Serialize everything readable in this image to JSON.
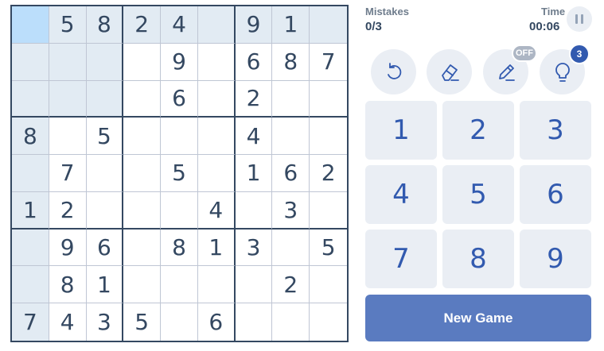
{
  "board": {
    "rows": [
      [
        "",
        "5",
        "8",
        "2",
        "4",
        "",
        "9",
        "1",
        ""
      ],
      [
        "",
        "",
        "",
        "",
        "9",
        "",
        "6",
        "8",
        "7"
      ],
      [
        "",
        "",
        "",
        "",
        "6",
        "",
        "2",
        "",
        ""
      ],
      [
        "8",
        "",
        "5",
        "",
        "",
        "",
        "4",
        "",
        ""
      ],
      [
        "",
        "7",
        "",
        "",
        "5",
        "",
        "1",
        "6",
        "2"
      ],
      [
        "1",
        "2",
        "",
        "",
        "",
        "4",
        "",
        "3",
        ""
      ],
      [
        "",
        "9",
        "6",
        "",
        "8",
        "1",
        "3",
        "",
        "5"
      ],
      [
        "",
        "8",
        "1",
        "",
        "",
        "",
        "",
        "2",
        ""
      ],
      [
        "7",
        "4",
        "3",
        "5",
        "",
        "6",
        "",
        "",
        ""
      ]
    ],
    "selected": {
      "row": 1,
      "col": 1
    }
  },
  "stats": {
    "mistakes_label": "Mistakes",
    "mistakes_value": "0/3",
    "time_label": "Time",
    "time_value": "00:06"
  },
  "tools": {
    "undo_icon": "undo-icon",
    "erase_icon": "eraser-icon",
    "notes_icon": "pencil-icon",
    "notes_badge": "OFF",
    "hint_icon": "lightbulb-icon",
    "hint_badge": "3"
  },
  "numpad": {
    "keys": [
      "1",
      "2",
      "3",
      "4",
      "5",
      "6",
      "7",
      "8",
      "9"
    ]
  },
  "new_game_label": "New Game",
  "colors": {
    "accent": "#325aaf",
    "button": "#5a7bc0",
    "highlight": "#e2ebf3",
    "selected": "#bbdefb",
    "text": "#344861"
  }
}
